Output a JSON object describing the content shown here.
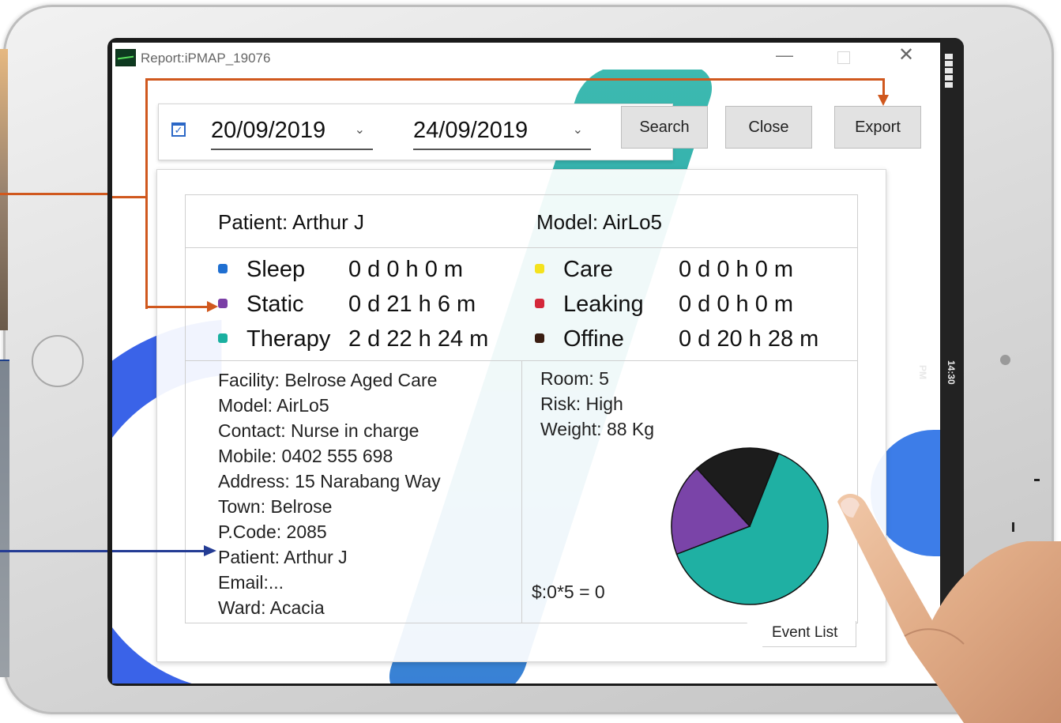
{
  "window": {
    "title": "Report:iPMAP_19076",
    "controls": {
      "minimize": "—",
      "maximize": "",
      "close": "✕"
    }
  },
  "device": {
    "clock": "14:30 PM"
  },
  "filters": {
    "date_from": "20/09/2019",
    "date_to": "24/09/2019",
    "dropdown_glyph": "⌄"
  },
  "buttons": {
    "search": "Search",
    "close": "Close",
    "export": "Export"
  },
  "report": {
    "patient": "Patient: Arthur J",
    "model": "Model: AirLo5",
    "stats_left": [
      {
        "label": "Sleep",
        "value": "0 d 0 h 0 m",
        "color": "#1f6fd1"
      },
      {
        "label": "Static",
        "value": "0 d 21 h 6 m",
        "color": "#7b3fa6"
      },
      {
        "label": "Therapy",
        "value": "2 d 22 h 24 m",
        "color": "#1ab0a0"
      }
    ],
    "stats_right": [
      {
        "label": "Care",
        "value": "0 d 0 h 0 m",
        "color": "#f4e21e"
      },
      {
        "label": "Leaking",
        "value": "0 d 0 h 0 m",
        "color": "#d4283a"
      },
      {
        "label": "Offine",
        "value": "0 d 20 h 28 m",
        "color": "#3a1e12"
      }
    ],
    "details_left": [
      "Facility: Belrose Aged Care",
      "Model: AirLo5",
      "Contact: Nurse in charge",
      "Mobile: 0402 555 698",
      "Address: 15 Narabang Way",
      "Town: Belrose",
      "P.Code: 2085",
      "Patient: Arthur J",
      "Email:...",
      "Ward: Acacia"
    ],
    "details_right": [
      "Room: 5",
      "Risk: High",
      "Weight: 88 Kg"
    ],
    "cost": "$:0*5 = 0",
    "event_list_tab": "Event List"
  },
  "pie": {
    "slices": [
      {
        "name": "Therapy",
        "share": 0.632,
        "color": "#1fb0a3"
      },
      {
        "name": "Static",
        "share": 0.19,
        "color": "#7a44a8"
      },
      {
        "name": "Offine",
        "share": 0.178,
        "color": "#1c1c1c"
      }
    ]
  }
}
